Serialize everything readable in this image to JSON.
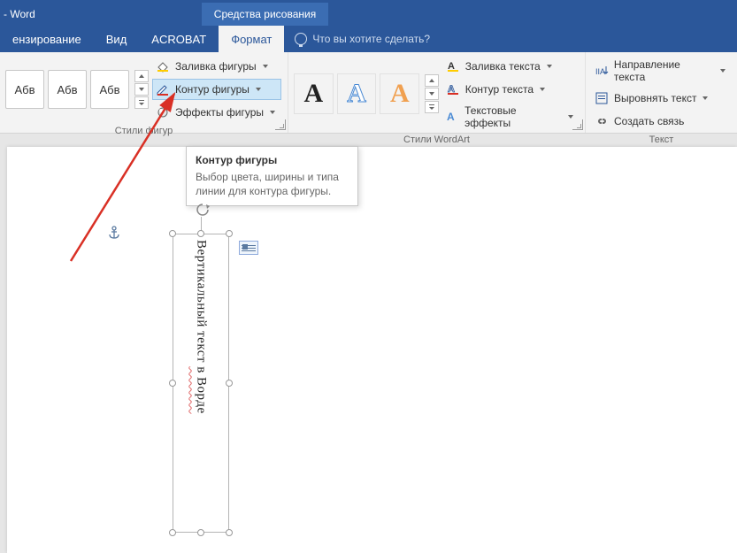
{
  "titlebar": {
    "app": "- Word",
    "tool_tab": "Средства рисования"
  },
  "tabs": {
    "review": "ензирование",
    "view": "Вид",
    "acrobat": "ACROBAT",
    "format": "Формат",
    "tell_me": "Что вы хотите сделать?"
  },
  "shape_styles": {
    "sample": "Абв",
    "fill": "Заливка фигуры",
    "outline": "Контур фигуры",
    "effects": "Эффекты фигуры",
    "group_label": "Стили фигур"
  },
  "wordart": {
    "glyph": "A",
    "fill": "Заливка текста",
    "outline": "Контур текста",
    "effects": "Текстовые эффекты",
    "group_label": "Стили WordArt"
  },
  "text_group": {
    "direction": "Направление текста",
    "align": "Выровнять текст",
    "link": "Создать связь",
    "group_label": "Текст"
  },
  "tooltip": {
    "title": "Контур фигуры",
    "body": "Выбор цвета, ширины и типа линии для контура фигуры."
  },
  "document": {
    "textbox_content_a": "Вертикальный текст ",
    "textbox_content_b": "в Ворде"
  }
}
